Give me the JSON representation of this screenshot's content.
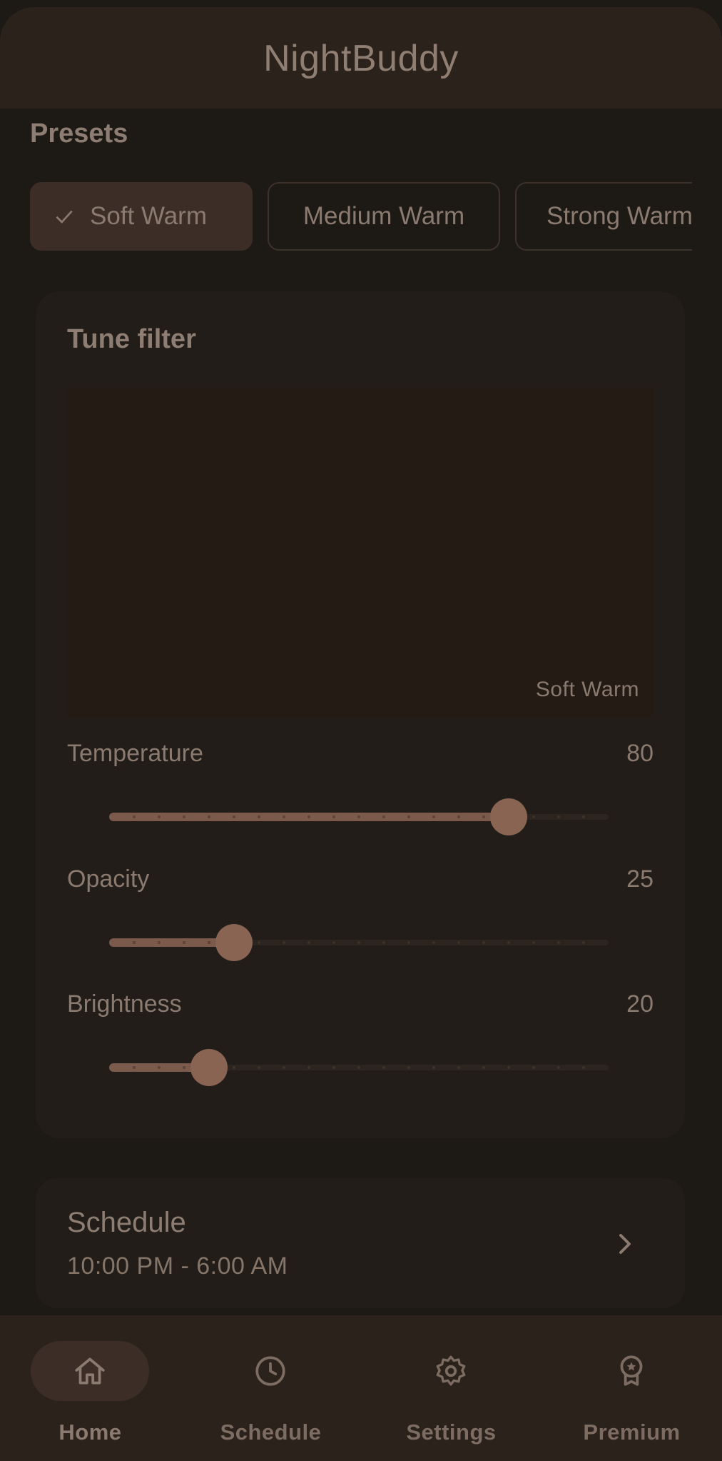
{
  "app": {
    "title": "NightBuddy"
  },
  "presets": {
    "label": "Presets",
    "items": [
      {
        "label": "Soft Warm",
        "selected": true
      },
      {
        "label": "Medium Warm",
        "selected": false
      },
      {
        "label": "Strong Warm",
        "selected": false
      }
    ]
  },
  "tune": {
    "title": "Tune filter",
    "preview_label": "Soft Warm",
    "sliders": [
      {
        "label": "Temperature",
        "value": "80",
        "level": 80
      },
      {
        "label": "Opacity",
        "value": "25",
        "level": 25
      },
      {
        "label": "Brightness",
        "value": "20",
        "level": 20
      }
    ]
  },
  "schedule": {
    "title": "Schedule",
    "time": "10:00 PM - 6:00 AM"
  },
  "nav": {
    "items": [
      {
        "label": "Home",
        "icon": "home-icon",
        "active": true
      },
      {
        "label": "Schedule",
        "icon": "clock-icon",
        "active": false
      },
      {
        "label": "Settings",
        "icon": "gear-icon",
        "active": false
      },
      {
        "label": "Premium",
        "icon": "award-icon",
        "active": false
      }
    ]
  },
  "colors": {
    "background": "#1d1915",
    "surface": "#221d19",
    "bar": "#2c221c",
    "accent": "#8a6453",
    "selected": "#3c2e26",
    "text": "#8a7a6f"
  }
}
